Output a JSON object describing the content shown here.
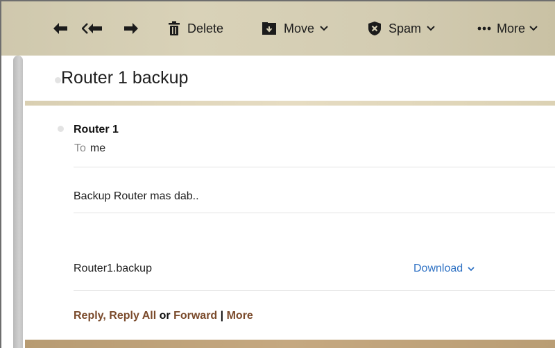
{
  "toolbar": {
    "reply_icon": "reply-arrow-icon",
    "reply_all_icon": "reply-all-arrows-icon",
    "forward_icon": "forward-arrow-icon",
    "delete_label": "Delete",
    "delete_icon": "trash-icon",
    "move_label": "Move",
    "move_icon": "move-to-folder-icon",
    "spam_label": "Spam",
    "spam_icon": "shield-x-icon",
    "more_label": "More",
    "more_icon": "ellipsis-icon"
  },
  "message": {
    "subject": "Router 1 backup",
    "sender": "Router 1",
    "to_label": "To",
    "to_value": "me",
    "body": "Backup Router mas dab..",
    "attachment_name": "Router1.backup",
    "download_label": "Download"
  },
  "actions": {
    "reply": "Reply",
    "comma": ",",
    "reply_all": "Reply All",
    "or": "or",
    "forward": "Forward",
    "separator": "|",
    "more": "More"
  },
  "colors": {
    "toolbar_bg": "#d6cfb5",
    "link_brown": "#7a4a2b",
    "link_blue": "#2f72c4",
    "band_tan": "#e6dcc2",
    "band_bottom": "#c5a880"
  }
}
